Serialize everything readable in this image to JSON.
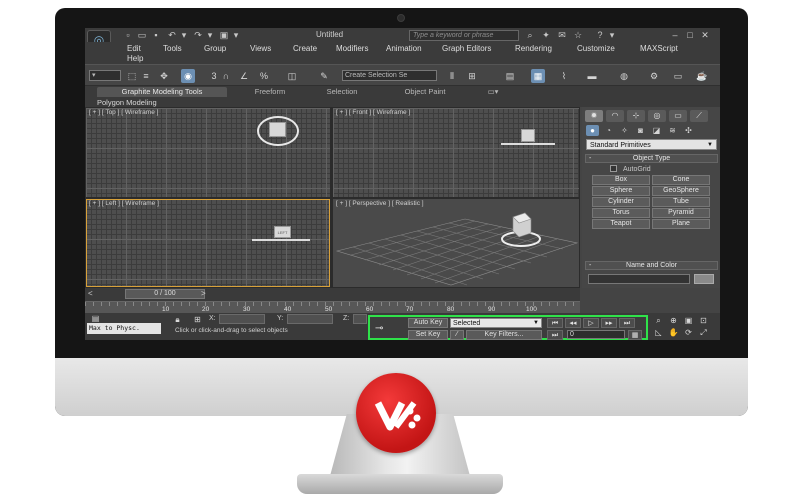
{
  "titlebar": {
    "doc_title": "Untitled",
    "search_placeholder": "Type a keyword or phrase",
    "help_symbol": "?"
  },
  "menu": {
    "items": [
      "Edit",
      "Tools",
      "Group",
      "Views",
      "Create",
      "Modifiers",
      "Animation",
      "Graph Editors",
      "Rendering",
      "Customize",
      "MAXScript",
      "Help"
    ]
  },
  "toolbar": {
    "selection_set_placeholder": "Create Selection Se",
    "snap_label": "3"
  },
  "ribbon": {
    "tabs": [
      "Graphite Modeling Tools",
      "Freeform",
      "Selection",
      "Object Paint"
    ],
    "active_tab": "Graphite Modeling Tools",
    "panel_label": "Polygon Modeling"
  },
  "viewports": {
    "top": "[ + ] [ Top ] [ Wireframe ]",
    "front": "[ + ] [ Front ] [ Wireframe ]",
    "left": "[ + ] [ Left ] [ Wireframe ]",
    "perspective": "[ + ] [ Perspective ] [ Realistic ]",
    "object_label": "LEFT"
  },
  "command_panel": {
    "category": "Standard Primitives",
    "object_type_title": "Object Type",
    "autogrid_label": "AutoGrid",
    "primitives": [
      "Box",
      "Cone",
      "Sphere",
      "GeoSphere",
      "Cylinder",
      "Tube",
      "Torus",
      "Pyramid",
      "Teapot",
      "Plane"
    ],
    "name_color_title": "Name and Color",
    "minus": "-"
  },
  "timeline": {
    "slider_label": "0 / 100",
    "prev": "<",
    "next": ">",
    "ticks": [
      "10",
      "20",
      "30",
      "40",
      "50",
      "60",
      "70",
      "80",
      "90",
      "100"
    ]
  },
  "status": {
    "maxscript_label": "Max to Physc.",
    "x_label": "X:",
    "y_label": "Y:",
    "z_label": "Z:",
    "prompt": "Click or click-and-drag to select objects"
  },
  "animation": {
    "auto_key": "Auto Key",
    "set_key": "Set Key",
    "key_mode": "Selected",
    "key_filters": "Key Filters...",
    "frame": "0"
  }
}
